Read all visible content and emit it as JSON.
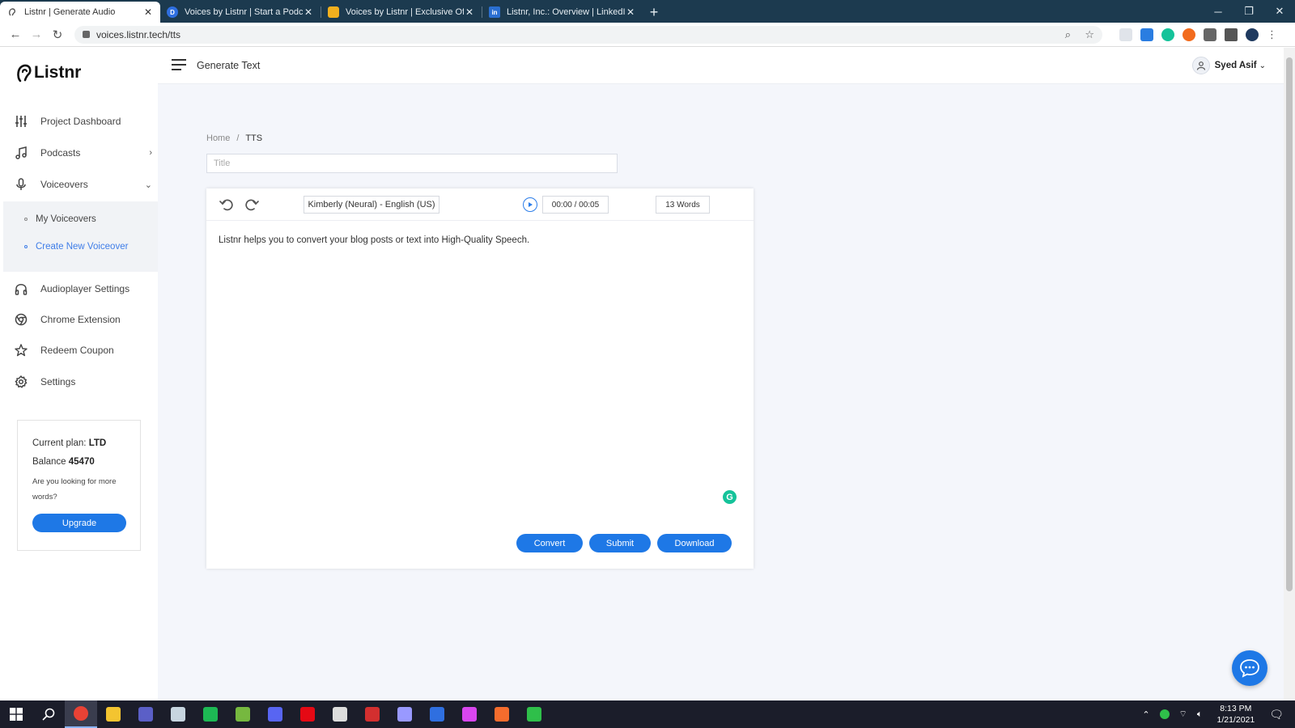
{
  "browser": {
    "tabs": [
      {
        "title": "Listnr | Generate Audio",
        "active": true,
        "favicon_color": "#555555"
      },
      {
        "title": "Voices by Listnr | Start a Podcast",
        "active": false,
        "favicon_color": "#2f6fe0"
      },
      {
        "title": "Voices by Listnr | Exclusive Offer",
        "active": false,
        "favicon_color": "#f2b01e"
      },
      {
        "title": "Listnr, Inc.: Overview | LinkedIn",
        "active": false,
        "favicon_color": "#2a6fd1"
      }
    ],
    "url": "voices.listnr.tech/tts"
  },
  "brand": {
    "name": "Listnr"
  },
  "sidebar": {
    "items": [
      {
        "label": "Project Dashboard",
        "icon": "sliders-icon"
      },
      {
        "label": "Podcasts",
        "icon": "music-note-icon",
        "chevron": "›"
      },
      {
        "label": "Voiceovers",
        "icon": "microphone-icon",
        "chevron": "⌄"
      },
      {
        "label": "Audioplayer Settings",
        "icon": "headphones-icon"
      },
      {
        "label": "Chrome Extension",
        "icon": "chrome-icon"
      },
      {
        "label": "Redeem Coupon",
        "icon": "star-icon"
      },
      {
        "label": "Settings",
        "icon": "gear-icon"
      }
    ],
    "subitems": [
      {
        "label": "My Voiceovers",
        "active": false
      },
      {
        "label": "Create New Voiceover",
        "active": true
      }
    ]
  },
  "plan": {
    "plan_label": "Current plan: ",
    "plan_value": "LTD",
    "balance_label": "Balance ",
    "balance_value": "45470",
    "hint": "Are you looking for more words?",
    "upgrade_label": "Upgrade"
  },
  "topbar": {
    "title": "Generate Text",
    "user": "Syed Asif",
    "user_chevron": "⌄"
  },
  "breadcrumb": {
    "home": "Home",
    "separator": "/",
    "current": "TTS"
  },
  "title_input": {
    "placeholder": "Title",
    "value": ""
  },
  "editor": {
    "voice": "Kimberly (Neural) - English (US)",
    "time": "00:00 / 00:05",
    "words": "13 Words",
    "text": "Listnr helps you to convert your blog posts or text into High-Quality Speech.",
    "grammarly": "G",
    "buttons": {
      "convert": "Convert",
      "submit": "Submit",
      "download": "Download"
    }
  },
  "taskbar": {
    "apps": [
      {
        "name": "chrome",
        "color": "#e94235"
      },
      {
        "name": "file-explorer",
        "color": "#f4c430"
      },
      {
        "name": "teams",
        "color": "#5b5fc7"
      },
      {
        "name": "steam",
        "color": "#c7d5e0"
      },
      {
        "name": "spotify",
        "color": "#1db954"
      },
      {
        "name": "utorrent",
        "color": "#76b83f"
      },
      {
        "name": "discord",
        "color": "#5865f2"
      },
      {
        "name": "netflix",
        "color": "#e50914"
      },
      {
        "name": "epic-games",
        "color": "#dddddd"
      },
      {
        "name": "vivaldi",
        "color": "#d32f2f"
      },
      {
        "name": "premiere-pro",
        "color": "#9999ff"
      },
      {
        "name": "bitwarden",
        "color": "#2f6fe0"
      },
      {
        "name": "gitkraken",
        "color": "#d946ef"
      },
      {
        "name": "origin",
        "color": "#f56c2d"
      },
      {
        "name": "freshbooks",
        "color": "#2fbf4a"
      }
    ],
    "time": "8:13 PM",
    "date": "1/21/2021"
  }
}
